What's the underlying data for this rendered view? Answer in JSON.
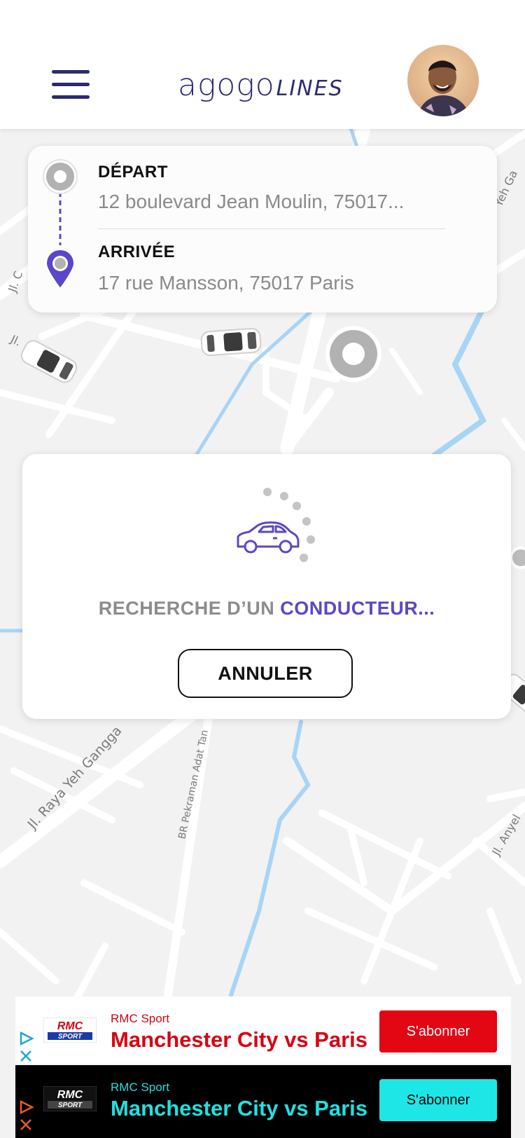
{
  "header": {
    "logo_main": "agogo",
    "logo_sub": "LINES",
    "menu_icon": "hamburger-menu-icon",
    "avatar_icon": "user-avatar"
  },
  "map": {
    "street_labels": [
      "Jl. Raya Yeh Gangga",
      "BR Pekraman Adat Tan",
      "Jl. Anyel",
      "Jl. C",
      "Jl.",
      "Yeh Ga"
    ]
  },
  "route": {
    "depart_label": "DÉPART",
    "depart_address": "12 boulevard Jean Moulin, 75017...",
    "arrival_label": "ARRIVÉE",
    "arrival_address": "17 rue Mansson, 75017 Paris",
    "accent_color": "#5a47c9"
  },
  "search": {
    "text_prefix": "RECHERCHE D’UN ",
    "text_highlight": "CONDUCTEUR...",
    "cancel_label": "ANNULER",
    "icon": "car-icon"
  },
  "ads": [
    {
      "sponsor": "RMC Sport",
      "headline": "Manchester City vs Paris",
      "cta": "S'abonner",
      "logo_top": "RMC",
      "logo_bottom": "SPORT"
    },
    {
      "sponsor": "RMC Sport",
      "headline": "Manchester City vs Paris",
      "cta": "S'abonner",
      "logo_top": "RMC",
      "logo_bottom": "SPORT"
    }
  ]
}
